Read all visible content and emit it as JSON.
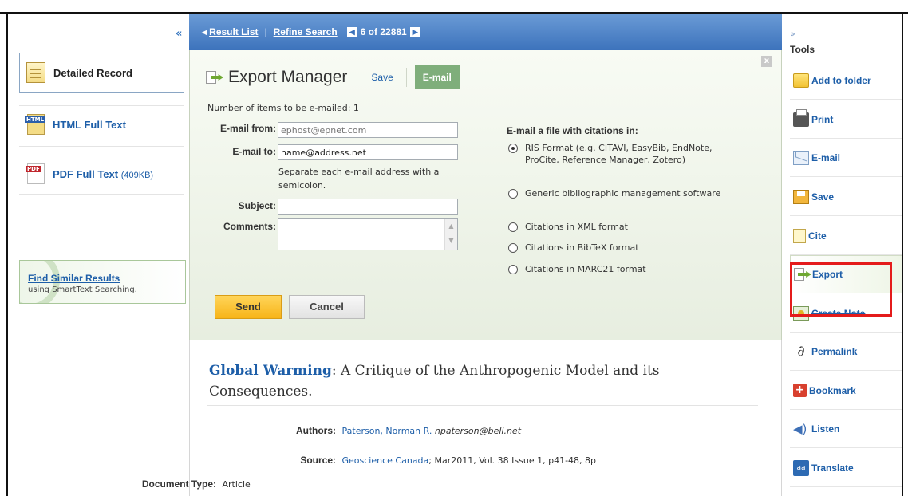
{
  "nav": {
    "result_list": "Result List",
    "refine_search": "Refine Search",
    "position": "6 of 22881"
  },
  "left": {
    "collapse": "«",
    "items": [
      {
        "label": "Detailed Record"
      },
      {
        "label": "HTML Full Text"
      },
      {
        "label": "PDF Full Text",
        "size": "(409KB)"
      }
    ],
    "find_similar": {
      "title": "Find Similar Results",
      "subtitle": "using SmartText Searching."
    }
  },
  "export_manager": {
    "title": "Export Manager",
    "save_tab": "Save",
    "email_tab": "E-mail",
    "close": "x",
    "count_text": "Number of items to be e-mailed: 1",
    "email_from_label": "E-mail from:",
    "email_from_placeholder": "ephost@epnet.com",
    "email_to_label": "E-mail to:",
    "email_to_value": "name@address.net",
    "email_to_help": "Separate each e-mail address with a semicolon.",
    "subject_label": "Subject:",
    "subject_value": "",
    "comments_label": "Comments:",
    "citation_title": "E-mail a file with citations in:",
    "formats": [
      {
        "label": "RIS Format (e.g. CITAVI, EasyBib, EndNote, ProCite, Reference Manager, Zotero)",
        "selected": true
      },
      {
        "label": "Generic bibliographic management software",
        "selected": false
      },
      {
        "label": "Citations in XML format",
        "selected": false
      },
      {
        "label": "Citations in BibTeX format",
        "selected": false
      },
      {
        "label": "Citations in MARC21 format",
        "selected": false
      }
    ],
    "send_label": "Send",
    "cancel_label": "Cancel"
  },
  "record": {
    "title_main": "Global Warming",
    "title_rest": ": A Critique of the Anthropogenic Model and its Consequences.",
    "authors_label": "Authors:",
    "authors_value": "Paterson, Norman R.",
    "authors_email": "npaterson@bell.net",
    "source_label": "Source:",
    "source_link": "Geoscience Canada",
    "source_rest": "; Mar2011, Vol. 38 Issue 1, p41-48, 8p",
    "doctype_label": "Document Type:",
    "doctype_value": "Article"
  },
  "tools": {
    "collapse": "»",
    "title": "Tools",
    "items": [
      {
        "label": "Add to folder",
        "icon": "folder-icon"
      },
      {
        "label": "Print",
        "icon": "printer-icon"
      },
      {
        "label": "E-mail",
        "icon": "envelope-icon"
      },
      {
        "label": "Save",
        "icon": "floppy-disk-icon"
      },
      {
        "label": "Cite",
        "icon": "citation-icon"
      },
      {
        "label": "Export",
        "icon": "export-icon"
      },
      {
        "label": "Create Note",
        "icon": "note-icon"
      },
      {
        "label": "Permalink",
        "icon": "link-icon"
      },
      {
        "label": "Bookmark",
        "icon": "bookmark-plus-icon"
      },
      {
        "label": "Listen",
        "icon": "speaker-icon"
      },
      {
        "label": "Translate",
        "icon": "translate-icon",
        "icon_text": "aa"
      }
    ],
    "highlight_color": "#e41b1b"
  }
}
